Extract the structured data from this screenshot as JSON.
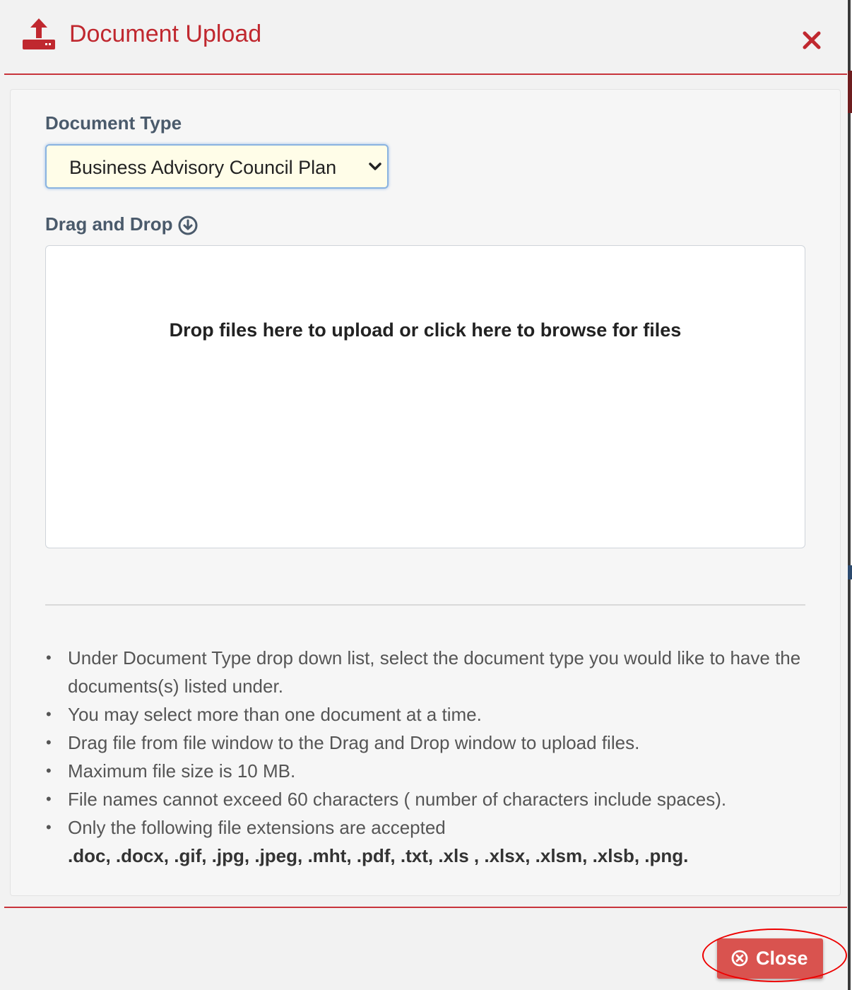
{
  "dialog": {
    "title": "Document Upload",
    "icons": {
      "header": "upload-icon",
      "close": "close-icon",
      "dnd": "arrow-down-circle-icon",
      "button": "x-circle-icon"
    },
    "colors": {
      "accent": "#c0282f",
      "button": "#d9534f",
      "select_bg": "#fffde8"
    }
  },
  "form": {
    "doc_type_label": "Document Type",
    "doc_type_value": "Business Advisory Council Plan",
    "dnd_label": "Drag and Drop",
    "dropzone_message": "Drop files here to upload or click here to browse for files"
  },
  "instructions": [
    "Under Document Type drop down list, select the document type you would like to have the documents(s) listed under.",
    "You may select more than one document at a time.",
    "Drag file from file window to the Drag and Drop window to upload files.",
    "Maximum file size is 10 MB.",
    "File names cannot exceed 60 characters ( number of characters include spaces).",
    "Only the following file extensions are accepted"
  ],
  "extensions": ".doc, .docx, .gif, .jpg, .jpeg, .mht, .pdf, .txt, .xls , .xlsx, .xlsm, .xlsb, .png.",
  "footer": {
    "close_label": "Close"
  }
}
